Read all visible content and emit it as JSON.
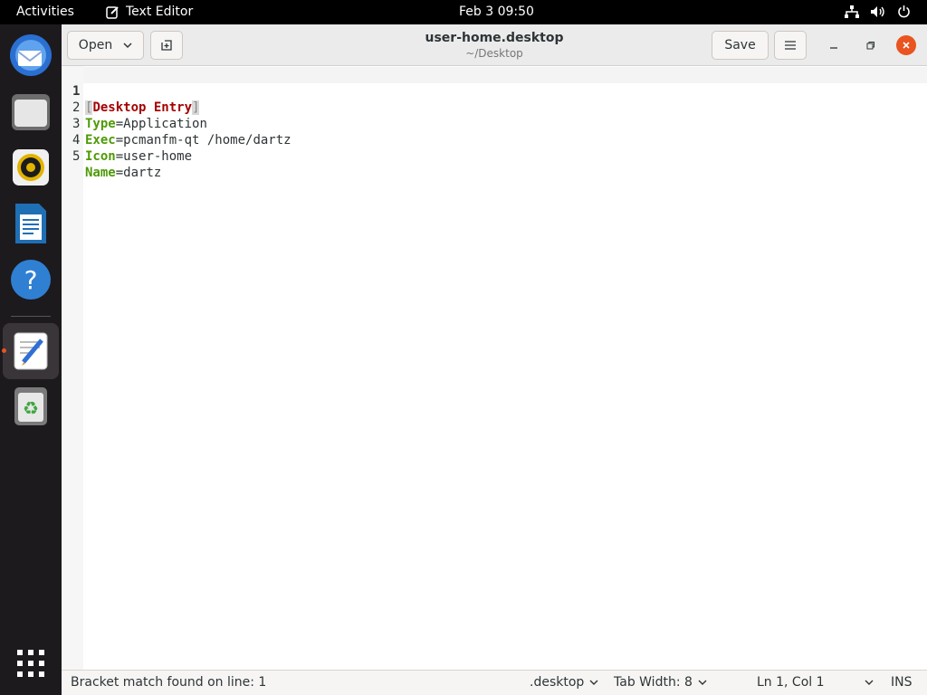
{
  "topbar": {
    "activities": "Activities",
    "app_name": "Text Editor",
    "clock": "Feb 3  09:50"
  },
  "dock": {
    "items": [
      "thunderbird-icon",
      "files-icon",
      "rhythmbox-icon",
      "libreoffice-writer-icon",
      "help-icon",
      "text-editor-icon",
      "trash-icon"
    ]
  },
  "header": {
    "open_label": "Open",
    "title": "user-home.desktop",
    "subtitle": "~/Desktop",
    "save_label": "Save"
  },
  "editor": {
    "lines": [
      {
        "num": "1",
        "open_bracket": "[",
        "section": "Desktop Entry",
        "close_bracket": "]"
      },
      {
        "num": "2",
        "key": "Type",
        "eq": "=",
        "value": "Application"
      },
      {
        "num": "3",
        "key": "Exec",
        "eq": "=",
        "value": "pcmanfm-qt /home/dartz"
      },
      {
        "num": "4",
        "key": "Icon",
        "eq": "=",
        "value": "user-home"
      },
      {
        "num": "5",
        "key": "Name",
        "eq": "=",
        "value": "dartz"
      }
    ]
  },
  "statusbar": {
    "message": "Bracket match found on line: 1",
    "language": ".desktop",
    "tab_width": "Tab Width: 8",
    "position": "Ln 1, Col 1",
    "mode": "INS"
  },
  "colors": {
    "accent": "#e95420",
    "key": "#4e9a06",
    "section": "#a40000"
  }
}
